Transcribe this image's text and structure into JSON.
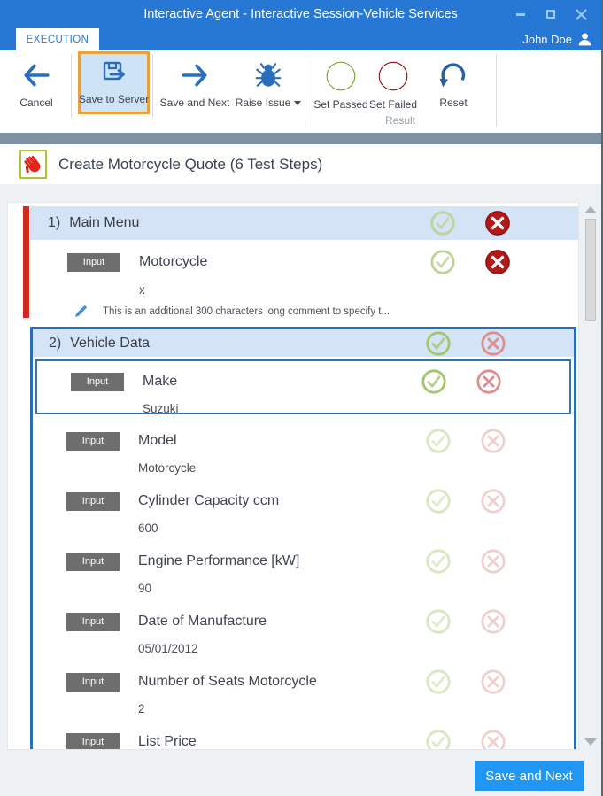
{
  "window": {
    "title": "Interactive Agent - Interactive Session-Vehicle Services"
  },
  "tabs": {
    "execution": "EXECUTION"
  },
  "user": {
    "name": "John Doe"
  },
  "toolbar": {
    "cancel": "Cancel",
    "save_to_server": "Save to Server",
    "save_and_next": "Save and Next",
    "raise_issue": "Raise Issue",
    "set_passed": "Set Passed",
    "set_failed": "Set Failed",
    "reset": "Reset",
    "result_group": "Result"
  },
  "session": {
    "title": "Create Motorcycle Quote (6 Test Steps)"
  },
  "steps": [
    {
      "number": "1)",
      "name": "Main Menu",
      "result": "failed",
      "rows": [
        {
          "badge": "Input",
          "label": "Motorcycle",
          "value": "x",
          "comment": "This is an additional 300 characters long comment to specify t...",
          "result": "failed"
        }
      ]
    },
    {
      "number": "2)",
      "name": "Vehicle Data",
      "result": "none",
      "rows": [
        {
          "badge": "Input",
          "label": "Make",
          "value": "Suzuki",
          "selected": true,
          "result": "none"
        },
        {
          "badge": "Input",
          "label": "Model",
          "value": "Motorcycle",
          "result": "none"
        },
        {
          "badge": "Input",
          "label": "Cylinder Capacity ccm",
          "value": "600",
          "result": "none"
        },
        {
          "badge": "Input",
          "label": "Engine Performance [kW]",
          "value": "90",
          "result": "none"
        },
        {
          "badge": "Input",
          "label": "Date of Manufacture",
          "value": "05/01/2012",
          "result": "none"
        },
        {
          "badge": "Input",
          "label": "Number of Seats Motorcycle",
          "value": "2",
          "result": "none"
        },
        {
          "badge": "Input",
          "label": "List Price",
          "value": "",
          "result": "none"
        }
      ]
    }
  ],
  "footer": {
    "save_and_next": "Save and Next"
  },
  "colors": {
    "titlebar_blue": "#2778d4",
    "toolbar_icon_blue": "#2a6ebb",
    "highlight_orange": "#e9a23b",
    "selected_border_blue": "#2b6cb5",
    "step_header_bg": "#d4e3f5",
    "failed_red": "#b21a1a",
    "failed_bar_red": "#d2281e",
    "passed_green": "#8db832",
    "pale_green": "#bed397",
    "pale_red": "#dd8f8f",
    "badge_gray": "#6e6e6e",
    "save_button_blue": "#2196f3",
    "divider_slate": "#7d92a5",
    "hand_box_border": "#afc52d"
  },
  "icons": {
    "cancel": "arrow-left",
    "save_to_server": "floppy-arrow",
    "save_and_next": "arrow-right",
    "raise_issue": "bug",
    "set_passed": "check-circle-green",
    "set_failed": "x-circle-red",
    "reset": "undo-arrow",
    "user": "person",
    "manual_step": "red-hand",
    "comment": "pencil",
    "pass": "check-circle",
    "fail": "x-circle"
  }
}
